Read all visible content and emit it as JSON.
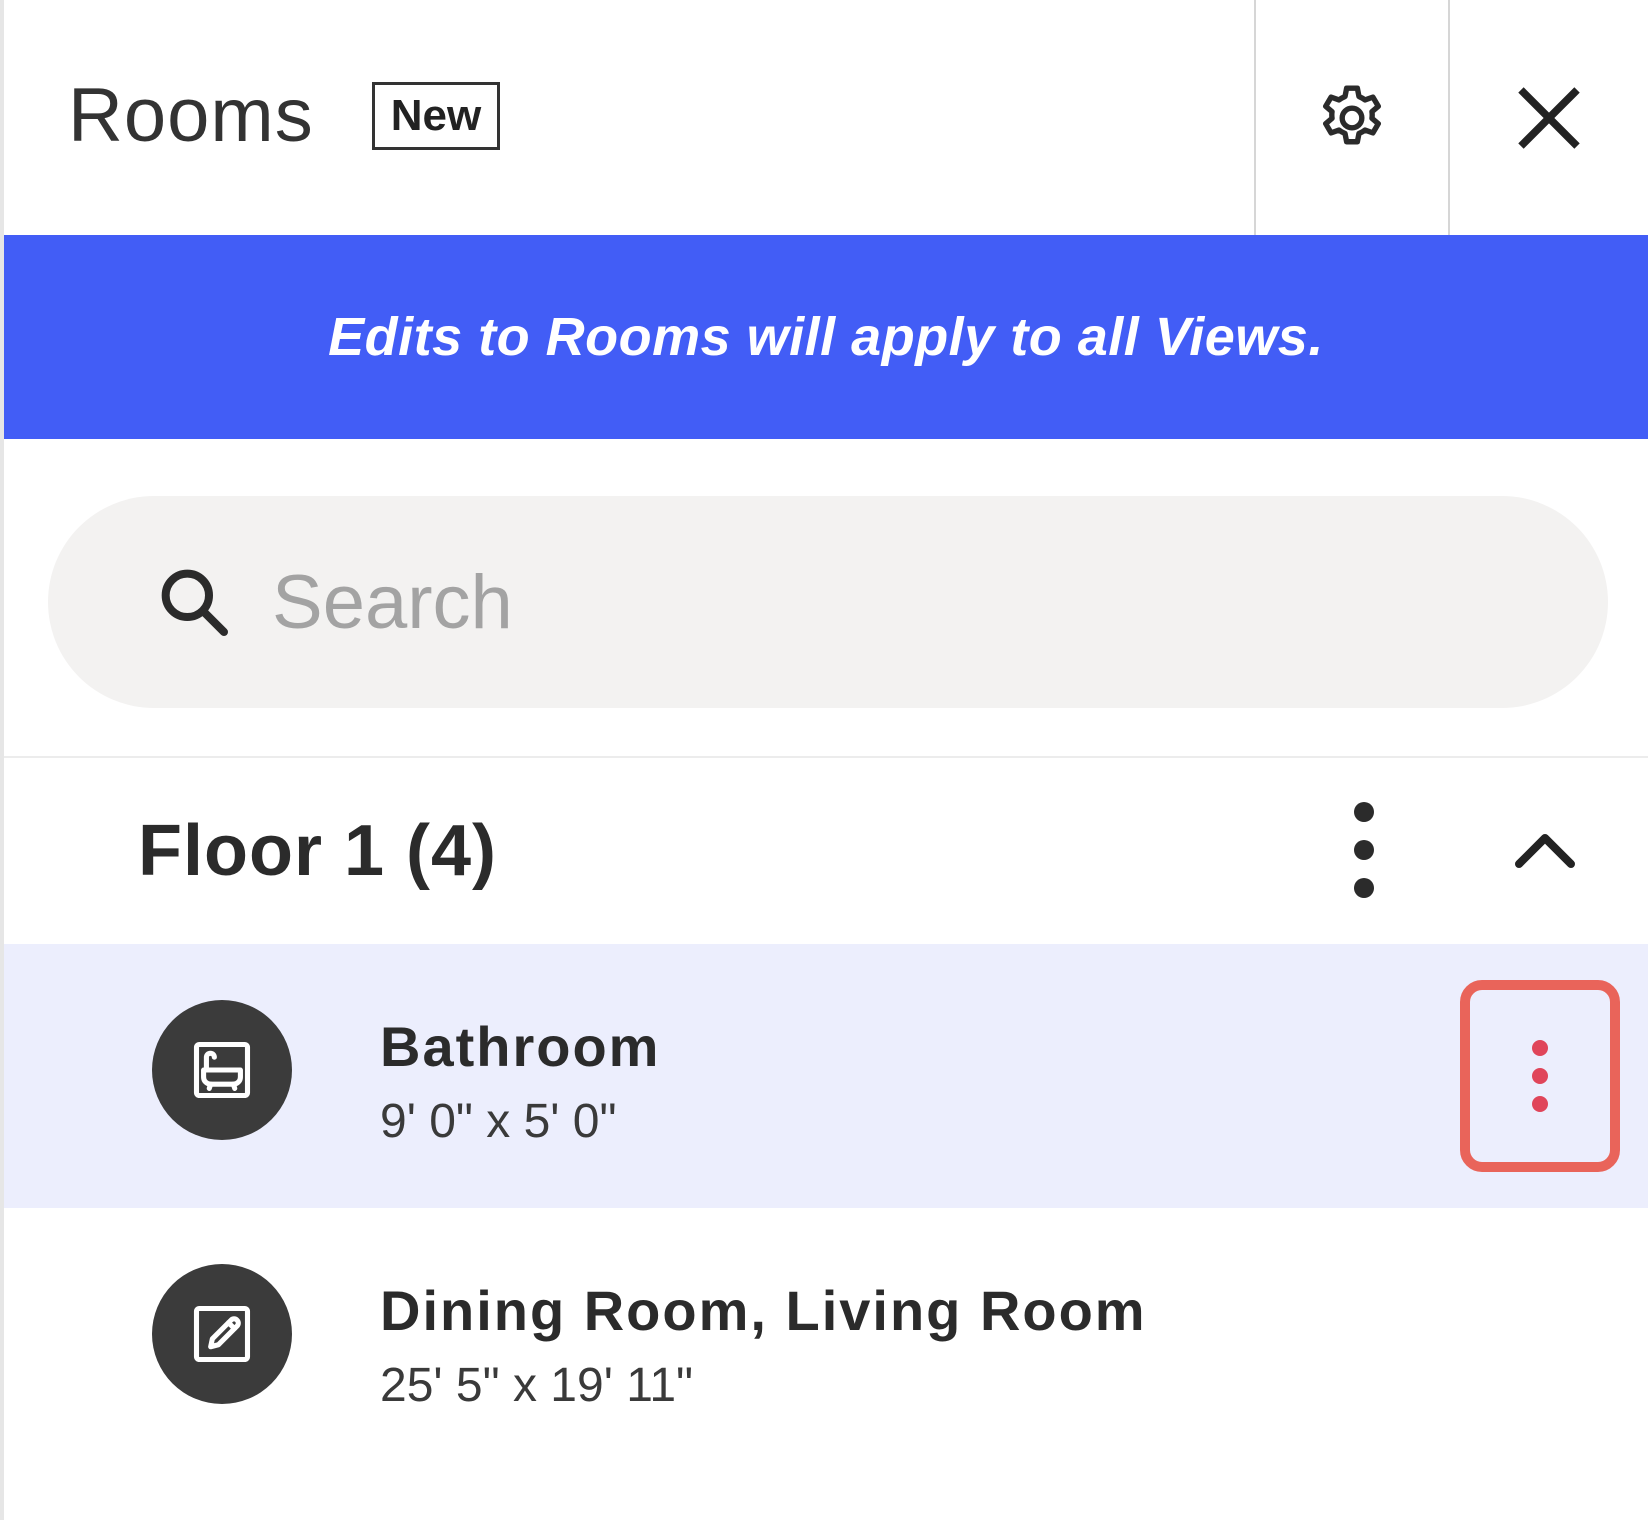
{
  "header": {
    "title": "Rooms",
    "badge": "New",
    "settings_icon": "gear-icon",
    "close_icon": "close-icon"
  },
  "banner": {
    "text": "Edits to Rooms will apply to all Views.",
    "color": "#425df6"
  },
  "search": {
    "placeholder": "Search",
    "value": "",
    "icon": "search-icon"
  },
  "floor": {
    "title": "Floor 1 (4)",
    "more_icon": "more-vertical-icon",
    "collapse_icon": "chevron-up-icon"
  },
  "rooms": [
    {
      "name": "Bathroom",
      "size": "9' 0\" x 5' 0\"",
      "icon": "bathtub-icon",
      "selected": true,
      "more_icon": "more-vertical-icon",
      "more_icon_color": "#e0455a",
      "highlight_color": "#e9645a"
    },
    {
      "name": "Dining Room, Living Room",
      "size": "25' 5\" x 19' 11\"",
      "icon": "edit-icon",
      "selected": false
    }
  ],
  "colors": {
    "selected_row": "#eceefd",
    "avatar": "#3b3b3b",
    "search_bg": "#f3f2f1"
  }
}
